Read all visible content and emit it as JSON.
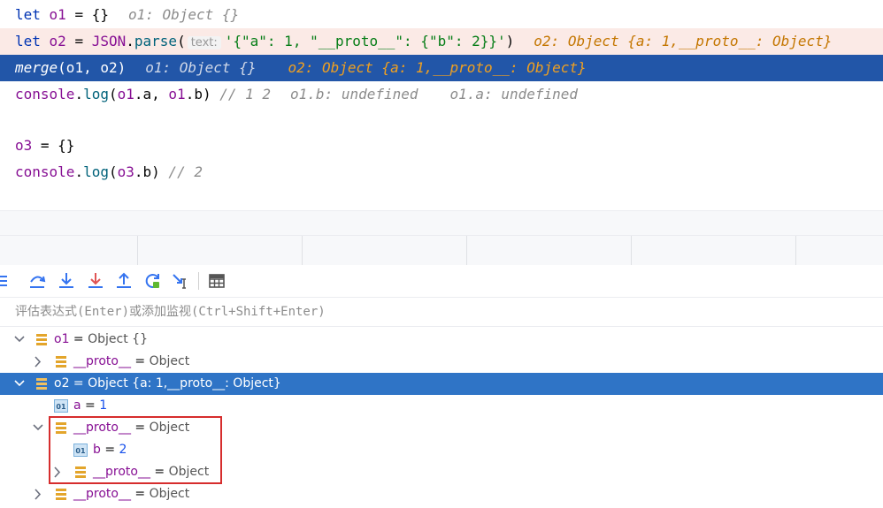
{
  "code": {
    "line1": {
      "let": "let",
      "name": "o1",
      "eq": " = ",
      "val": "{}",
      "hint": "o1: Object {}"
    },
    "line2": {
      "let": "let",
      "name": "o2",
      "eq": " = ",
      "json": "JSON",
      "dot": ".",
      "fn": "parse",
      "open": "(",
      "param_hint": "text:",
      "str": "'{\"a\": 1, \"__proto__\": {\"b\": 2}}'",
      "close": ")",
      "hint": "o2: Object {a: 1,__proto__: Object}"
    },
    "line3": {
      "fn": "merge",
      "args": "(o1, o2)",
      "hint1": "o1: Object {}",
      "hint2": "o2: Object {a: 1,__proto__: Object}"
    },
    "line4": {
      "obj": "console",
      "dot": ".",
      "fn": "log",
      "open": "(",
      "a1": "o1",
      "p1": ".a",
      "comma": ", ",
      "a2": "o1",
      "p2": ".b",
      "close": ")",
      "cmt": " // 1 2",
      "hint1": "o1.b: undefined",
      "hint2": "o1.a: undefined"
    },
    "line5": {
      "name": "o3",
      "eq": " = ",
      "val": "{}"
    },
    "line6": {
      "obj": "console",
      "dot": ".",
      "fn": "log",
      "open": "(",
      "a1": "o3",
      "p1": ".b",
      "close": ")",
      "cmt": " // 2"
    }
  },
  "eval_placeholder": "评估表达式(Enter)或添加监视(Ctrl+Shift+Enter)",
  "tree": {
    "rows": [
      {
        "name": "o1",
        "eq": " = ",
        "value": "Object {}"
      },
      {
        "name": "__proto__",
        "eq": " = ",
        "value": "Object"
      },
      {
        "name": "o2",
        "eq": " = ",
        "value": "Object {a: 1,__proto__: Object}"
      },
      {
        "name": "a",
        "eq": " = ",
        "value": "1"
      },
      {
        "name": "__proto__",
        "eq": " = ",
        "value": "Object"
      },
      {
        "name": "b",
        "eq": " = ",
        "value": "2"
      },
      {
        "name": "__proto__",
        "eq": " = ",
        "value": "Object"
      },
      {
        "name": "__proto__",
        "eq": " = ",
        "value": "Object"
      }
    ],
    "prim_badge": "01"
  },
  "colors": {
    "selection": "#2f74c6",
    "editor_selection": "#2256a8",
    "highlight_box": "#d62d2d",
    "error_line": "#fbeae6"
  },
  "icons": [
    "menu-icon",
    "step-over-icon",
    "step-into-icon",
    "force-step-into-icon",
    "step-out-icon",
    "restart-frame-icon",
    "run-to-cursor-icon",
    "evaluate-table-icon"
  ]
}
